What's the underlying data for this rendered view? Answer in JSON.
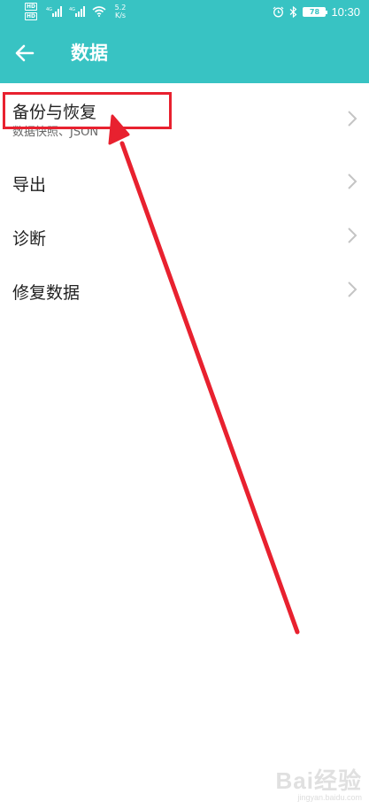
{
  "status_bar": {
    "hd_badges": [
      "HD",
      "HD"
    ],
    "net_labels": [
      "4G",
      "4G"
    ],
    "speed_value": "5.2",
    "speed_unit": "K/s",
    "battery_level": "78",
    "time": "10:30",
    "icons": [
      "alarm-icon",
      "bluetooth-icon",
      "wifi-icon",
      "signal-icon"
    ]
  },
  "app_bar": {
    "title": "数据",
    "back_icon": "arrow-left-icon",
    "color": "#38c3c3"
  },
  "menu": {
    "items": [
      {
        "title": "备份与恢复",
        "subtitle": "数据快照、JSON"
      },
      {
        "title": "导出"
      },
      {
        "title": "诊断"
      },
      {
        "title": "修复数据"
      }
    ],
    "chevron_icon": "chevron-right-icon"
  },
  "annotation": {
    "color": "#e8212f",
    "shapes": [
      "highlight-box",
      "pointer-arrow"
    ]
  },
  "watermark": {
    "logo": "Bai经验",
    "site": "jingyan.baidu.com"
  }
}
